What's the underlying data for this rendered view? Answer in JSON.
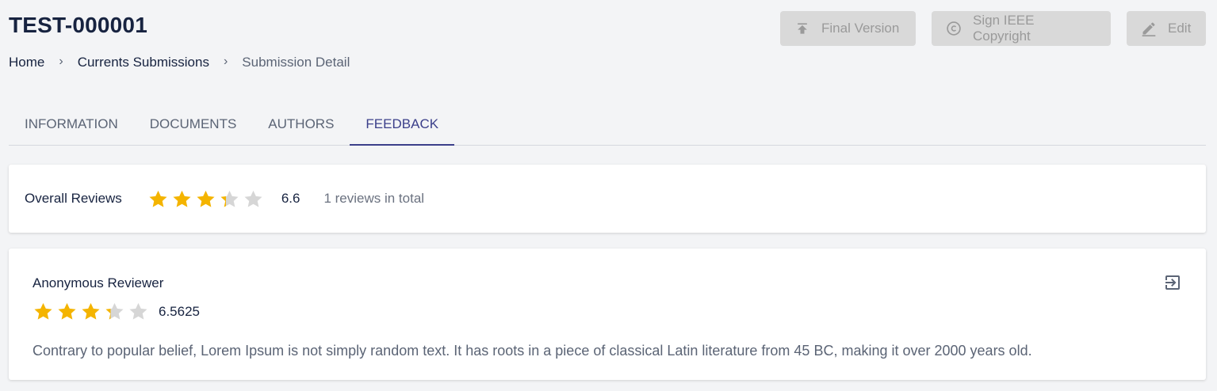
{
  "header": {
    "title": "TEST-000001",
    "breadcrumb": [
      "Home",
      "Currents Submissions",
      "Submission Detail"
    ]
  },
  "actions": {
    "final_version": "Final Version",
    "sign_copyright": "Sign IEEE Copyright",
    "edit": "Edit"
  },
  "tabs": [
    "INFORMATION",
    "DOCUMENTS",
    "AUTHORS",
    "FEEDBACK"
  ],
  "active_tab": "FEEDBACK",
  "overall": {
    "label": "Overall Reviews",
    "rating_fraction": 0.66,
    "score": "6.6",
    "total_text": "1 reviews in total"
  },
  "review": {
    "reviewer": "Anonymous Reviewer",
    "rating_fraction": 0.65625,
    "score": "6.5625",
    "text": "Contrary to popular belief, Lorem Ipsum is not simply random text. It has roots in a piece of classical Latin literature from 45 BC, making it over 2000 years old."
  },
  "colors": {
    "accent": "#3b3f8a",
    "star_filled": "#f4b400",
    "star_empty": "#d6d6d6",
    "disabled_button": "#d9d9d9"
  },
  "icons": {
    "final_version": "upload-icon",
    "sign_copyright": "copyright-icon",
    "edit": "pencil-icon",
    "export": "exit-to-app-icon"
  }
}
